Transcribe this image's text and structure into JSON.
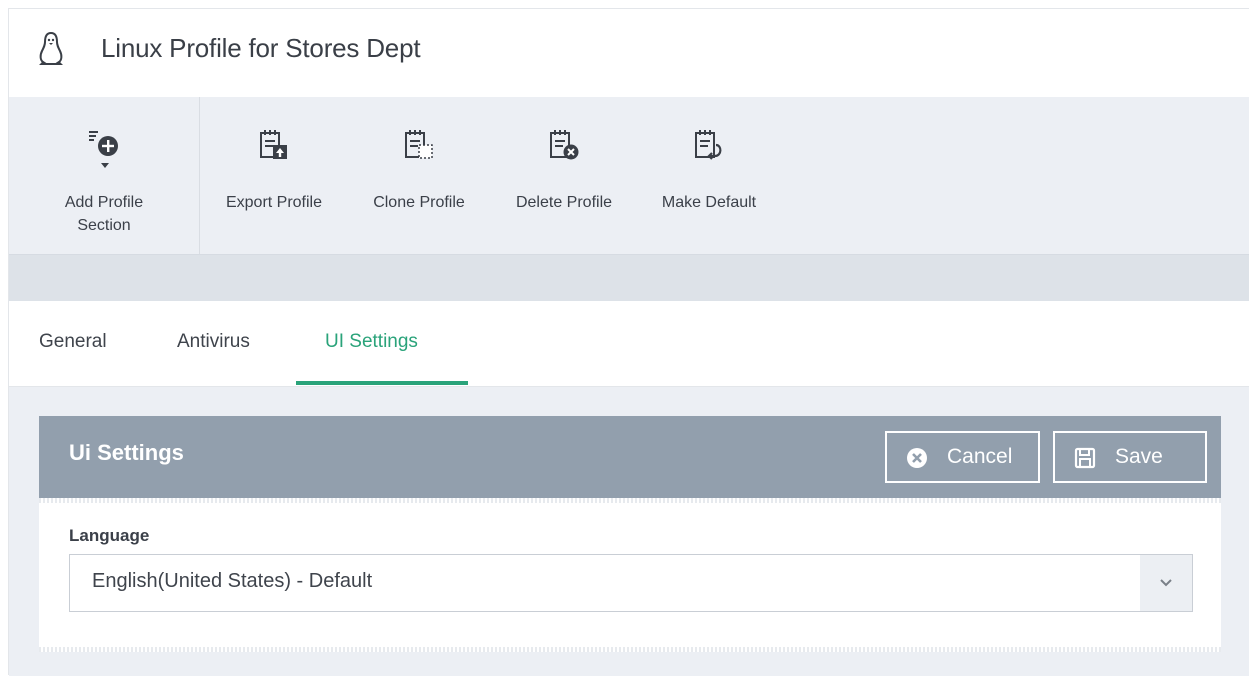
{
  "header": {
    "title": "Linux Profile for Stores Dept",
    "icon": "linux-penguin-icon"
  },
  "toolbar": {
    "add_profile_section": "Add Profile Section",
    "add_line1": "Add Profile",
    "add_line2": "Section",
    "export": "Export Profile",
    "clone": "Clone Profile",
    "delete": "Delete Profile",
    "make_default": "Make Default"
  },
  "tabs": [
    {
      "label": "General",
      "active": false
    },
    {
      "label": "Antivirus",
      "active": false
    },
    {
      "label": "UI Settings",
      "active": true
    }
  ],
  "panel": {
    "title": "Ui Settings",
    "cancel_label": "Cancel",
    "save_label": "Save"
  },
  "language": {
    "label": "Language",
    "value": "English(United States) - Default"
  },
  "colors": {
    "accent": "#2aa37a",
    "panel_header": "#929fad",
    "toolbar_bg": "#eceff4"
  }
}
